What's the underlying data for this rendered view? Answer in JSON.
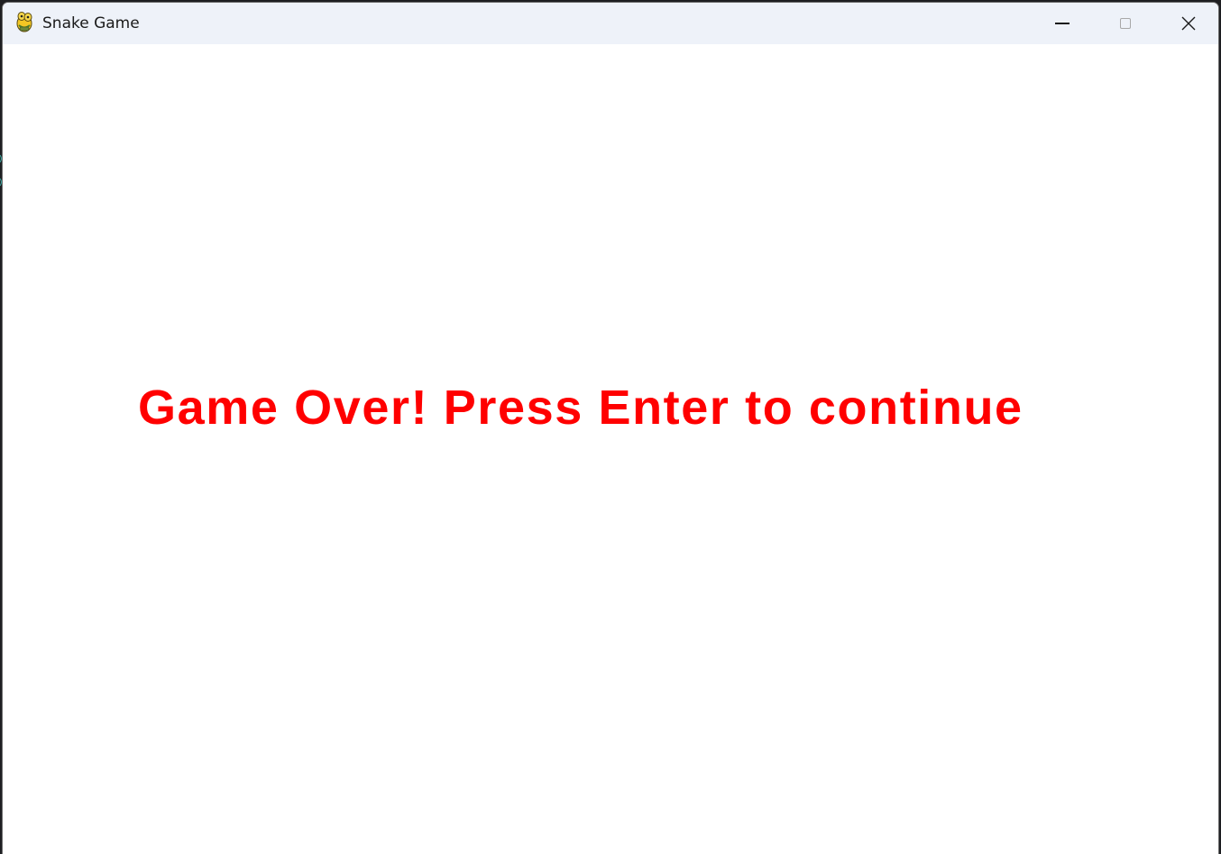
{
  "window": {
    "title": "Snake Game",
    "icon": "pygame-snake-icon"
  },
  "controls": {
    "minimize": "minimize-icon",
    "maximize": "maximize-icon",
    "close": "close-icon"
  },
  "game": {
    "message": "Game Over! Press Enter to continue",
    "message_color": "#ff0000",
    "background_color": "#ffffff"
  }
}
